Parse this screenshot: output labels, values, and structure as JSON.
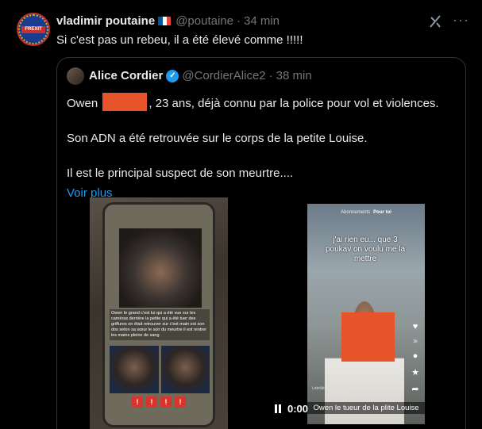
{
  "tweet": {
    "author_name": "vladimir poutaine",
    "handle": "@poutaine",
    "separator": "·",
    "time": "34 min",
    "avatar_badge": "FREXIT",
    "text": "Si c'est pas un rebeu, il a été élevé comme !!!!!",
    "flag_colors": [
      "#0055a4",
      "#ffffff",
      "#ef4135"
    ]
  },
  "quoted": {
    "author_name": "Alice Cordier",
    "handle": "@CordierAlice2",
    "separator": "·",
    "time": "38 min",
    "verified_icon": "verified-icon",
    "line1_before": "Owen",
    "line1_after": ", 23 ans, déjà connu par la police pour vol et violences.",
    "line2": "Son ADN a été retrouvée sur le corps de la petite Louise.",
    "line3": "Il est le principal suspect de son meurtre....",
    "show_more": "Voir plus"
  },
  "media": {
    "left_overlay_text": "Owen le grand c'est lui qui a été vue sur les caméras derrière la petite qui a été tuer des griffures on était retrouver sur c'est main est son dos selon sa sœur le soir du meurtre il est rentrer les mains pleine de sang",
    "right_top_tabs": [
      "Abonnements",
      "Pour toi"
    ],
    "right_caption": "j'ai rien eu... que 3 poukav on voulu me la mettre",
    "right_subtitle": "Owen le  tueur de la plite Louise",
    "right_footer": "Lebrâbler · @Elans",
    "like_count": "1k",
    "play_time": "0:00"
  },
  "colors": {
    "accent": "#1d9bf0",
    "redaction": "#e8542a",
    "muted": "#71767b"
  }
}
